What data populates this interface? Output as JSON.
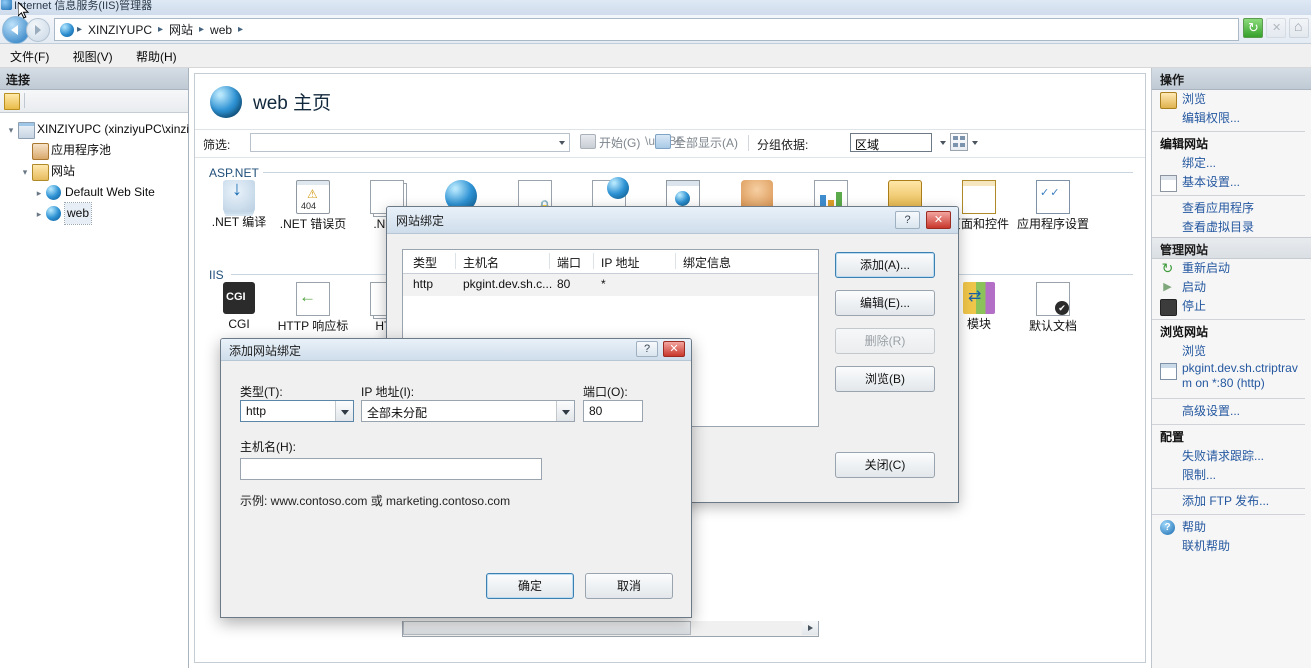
{
  "window": {
    "title": "Internet 信息服务(IIS)管理器"
  },
  "address": {
    "crumbs": [
      "XINZIYUPC",
      "网站",
      "web"
    ],
    "buttons": [
      {
        "name": "refresh",
        "label": "刷新"
      },
      {
        "name": "stop",
        "label": "停止"
      },
      {
        "name": "home",
        "label": "主页"
      }
    ]
  },
  "menu": {
    "items": [
      "文件(F)",
      "视图(V)",
      "帮助(H)"
    ]
  },
  "connections": {
    "header": "连接",
    "tree": [
      {
        "label": "XINZIYUPC (xinziyuPC\\xinzi",
        "icon": "server-icon",
        "indent": 0,
        "expander": "▾"
      },
      {
        "label": "应用程序池",
        "icon": "app-pool-icon",
        "indent": 1,
        "expander": ""
      },
      {
        "label": "网站",
        "icon": "folder-icon",
        "indent": 1,
        "expander": "▾"
      },
      {
        "label": "Default Web Site",
        "icon": "globe-icon",
        "indent": 2,
        "expander": "▸"
      },
      {
        "label": "web",
        "icon": "globe-icon",
        "indent": 2,
        "expander": "▸",
        "selected": true
      }
    ]
  },
  "page": {
    "title": "web 主页",
    "filter_label": "筛选:",
    "filter_value": "",
    "start_label": "开始(G)",
    "showall_label": "全部显示(A)",
    "groupby_label": "分组依据:",
    "groupby_value": "区域",
    "groups": [
      {
        "name": "ASP.NET",
        "icons": [
          {
            "label": ".NET 编译",
            "glyph": "g-dl",
            "icon": "dotnet-compile-icon"
          },
          {
            "label": ".NET 错误页",
            "glyph": "g-404",
            "icon": "dotnet-error-pages-icon"
          },
          {
            "label": ".NET",
            "glyph": "g-pages",
            "icon": "dotnet-pages-icon"
          },
          {
            "label": "",
            "glyph": "g-globe",
            "icon": "dotnet-globalization-icon"
          },
          {
            "label": "",
            "glyph": "g-doclock",
            "icon": "dotnet-trust-levels-icon"
          },
          {
            "label": "",
            "glyph": "g-globedoc",
            "icon": "dotnet-profile-icon"
          },
          {
            "label": "",
            "glyph": "g-win",
            "icon": "dotnet-roles-icon"
          },
          {
            "label": "",
            "glyph": "g-person",
            "icon": "dotnet-users-icon"
          },
          {
            "label": "",
            "glyph": "g-chart",
            "icon": "machine-key-icon"
          },
          {
            "label": "",
            "glyph": "g-gold",
            "icon": "session-state-icon"
          },
          {
            "label": "页面和控件",
            "glyph": "g-pagectl",
            "icon": "pages-and-controls-icon"
          },
          {
            "label": "应用程序设置",
            "glyph": "g-appset",
            "icon": "application-settings-icon"
          }
        ]
      },
      {
        "name": "IIS",
        "icons": [
          {
            "label": "CGI",
            "glyph": "g-cgi",
            "icon": "cgi-icon"
          },
          {
            "label": "HTTP 响应标",
            "glyph": "g-httpresp",
            "icon": "http-response-headers-icon"
          },
          {
            "label": "HTT",
            "glyph": "g-pages",
            "icon": "http-redirect-icon"
          },
          {
            "label": "模块",
            "glyph": "g-module",
            "icon": "modules-icon"
          },
          {
            "label": "默认文档",
            "glyph": "g-defdoc",
            "icon": "default-document-icon"
          }
        ]
      }
    ]
  },
  "actions": {
    "header": "操作",
    "items": [
      {
        "label": "浏览",
        "icon": "browse-icon",
        "kind": "link"
      },
      {
        "label": "编辑权限...",
        "icon": "",
        "kind": "link"
      },
      {
        "kind": "separator"
      },
      {
        "label": "编辑网站",
        "icon": "",
        "kind": "grouphead"
      },
      {
        "label": "绑定...",
        "icon": "",
        "kind": "link"
      },
      {
        "label": "基本设置...",
        "icon": "basic-settings-icon",
        "kind": "link"
      },
      {
        "kind": "separator"
      },
      {
        "label": "查看应用程序",
        "icon": "",
        "kind": "link"
      },
      {
        "label": "查看虚拟目录",
        "icon": "",
        "kind": "link"
      },
      {
        "label": "管理网站",
        "kind": "groupbar"
      },
      {
        "label": "重新启动",
        "icon": "restart-icon",
        "kind": "link"
      },
      {
        "label": "启动",
        "icon": "start-icon",
        "kind": "link"
      },
      {
        "label": "停止",
        "icon": "stop-icon",
        "kind": "link"
      },
      {
        "kind": "separator"
      },
      {
        "label": "浏览网站",
        "icon": "",
        "kind": "grouphead"
      },
      {
        "label": "浏览",
        "icon": "",
        "kind": "link"
      },
      {
        "label": "pkgint.dev.sh.ctriptrav",
        "label2": "m on *:80 (http)",
        "icon": "browse-site-icon",
        "kind": "link2"
      },
      {
        "kind": "separator"
      },
      {
        "label": "高级设置...",
        "icon": "",
        "kind": "link"
      },
      {
        "kind": "separator"
      },
      {
        "label": "配置",
        "icon": "",
        "kind": "grouphead"
      },
      {
        "label": "失败请求跟踪...",
        "icon": "",
        "kind": "link"
      },
      {
        "label": "限制...",
        "icon": "",
        "kind": "link"
      },
      {
        "kind": "separator"
      },
      {
        "label": "添加 FTP 发布...",
        "icon": "",
        "kind": "link"
      },
      {
        "kind": "separator"
      },
      {
        "label": "帮助",
        "icon": "help-icon",
        "kind": "link"
      },
      {
        "label": "联机帮助",
        "icon": "",
        "kind": "link"
      }
    ]
  },
  "site_bindings_dialog": {
    "title": "网站绑定",
    "help_button": "?",
    "close_button": "✕",
    "columns": [
      "类型",
      "主机名",
      "端口",
      "IP 地址",
      "绑定信息"
    ],
    "rows": [
      {
        "type": "http",
        "hostname": "pkgint.dev.sh.c...",
        "port": "80",
        "ip": "*",
        "info": ""
      }
    ],
    "buttons": [
      {
        "label": "添加(A)...",
        "name": "add-binding-button",
        "state": "default"
      },
      {
        "label": "编辑(E)...",
        "name": "edit-binding-button",
        "state": "normal"
      },
      {
        "label": "删除(R)",
        "name": "delete-binding-button",
        "state": "disabled"
      },
      {
        "label": "浏览(B)",
        "name": "browse-binding-button",
        "state": "normal"
      },
      {
        "label": "关闭(C)",
        "name": "close-bindings-button",
        "state": "normal"
      }
    ]
  },
  "add_binding_dialog": {
    "title": "添加网站绑定",
    "help_button": "?",
    "close_button": "✕",
    "type_label": "类型(T):",
    "type_value": "http",
    "ip_label": "IP 地址(I):",
    "ip_value": "全部未分配",
    "port_label": "端口(O):",
    "port_value": "80",
    "host_label": "主机名(H):",
    "host_value": "",
    "example_text": "示例: www.contoso.com 或 marketing.contoso.com",
    "ok_label": "确定",
    "cancel_label": "取消"
  }
}
